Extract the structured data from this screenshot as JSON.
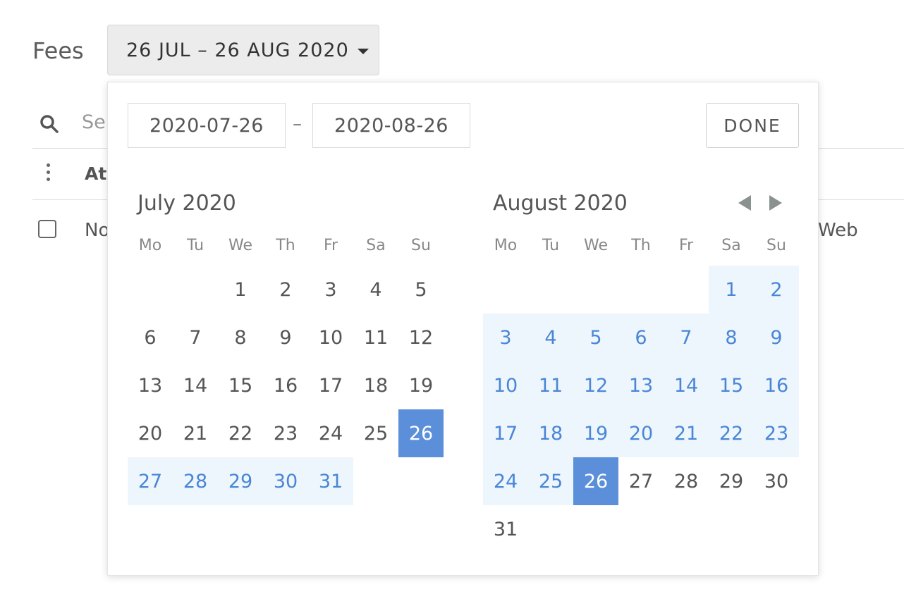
{
  "header": {
    "title": "Fees",
    "range_button": "26 JUL – 26 AUG 2020"
  },
  "page": {
    "search_placeholder": "Se",
    "column_header": "At",
    "row_text": "No",
    "row_text_right": "Web"
  },
  "picker": {
    "from_value": "2020-07-26",
    "to_value": "2020-08-26",
    "separator": "–",
    "done_label": "DONE",
    "weekdays": [
      "Mo",
      "Tu",
      "We",
      "Th",
      "Fr",
      "Sa",
      "Su"
    ],
    "months": [
      {
        "title": "July 2020",
        "first_weekday": 2,
        "days_in_month": 31,
        "range_start": 26,
        "range_end": 31,
        "endpoint": 26
      },
      {
        "title": "August 2020",
        "first_weekday": 5,
        "days_in_month": 31,
        "range_start": 1,
        "range_end": 26,
        "endpoint": 26
      }
    ]
  },
  "colors": {
    "accent": "#5b8fd9",
    "range_bg": "#eef6fd",
    "range_text": "#4a86d6"
  }
}
